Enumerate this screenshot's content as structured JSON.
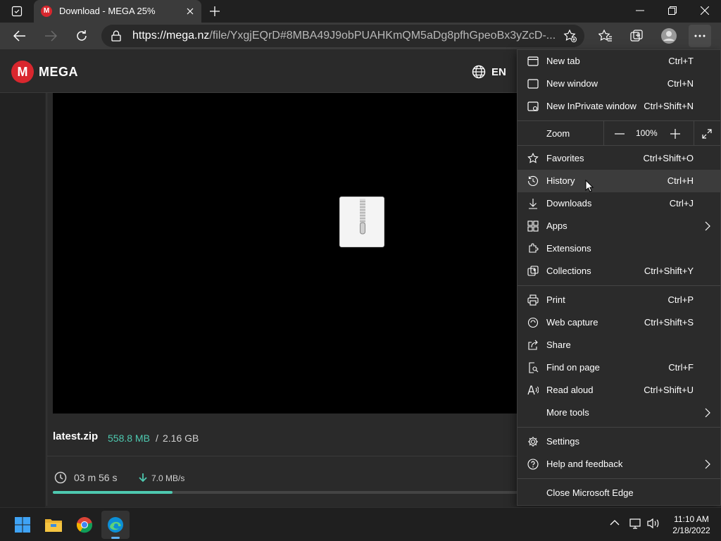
{
  "browser": {
    "tab_title": "Download - MEGA 25%",
    "tab_favicon": "M",
    "url_host": "https://mega.nz",
    "url_path": "/file/YxgjEQrD#8MBA49J9obPUAHKmQM5aDg8pfhGpeoBx3yZcD-..."
  },
  "mega": {
    "logo": "M",
    "name": "MEGA",
    "language": "EN",
    "file_name": "latest.zip",
    "downloaded": "558.8 MB",
    "separator": "/",
    "total": "2.16 GB",
    "time_left": "03 m  56 s",
    "speed": "7.0 MB/s",
    "progress": 0.25
  },
  "menu": {
    "new_tab": {
      "label": "New tab",
      "shortcut": "Ctrl+T"
    },
    "new_window": {
      "label": "New window",
      "shortcut": "Ctrl+N"
    },
    "new_inprivate": {
      "label": "New InPrivate window",
      "shortcut": "Ctrl+Shift+N"
    },
    "zoom": {
      "label": "Zoom",
      "value": "100%"
    },
    "favorites": {
      "label": "Favorites",
      "shortcut": "Ctrl+Shift+O"
    },
    "history": {
      "label": "History",
      "shortcut": "Ctrl+H"
    },
    "downloads": {
      "label": "Downloads",
      "shortcut": "Ctrl+J"
    },
    "apps": {
      "label": "Apps"
    },
    "extensions": {
      "label": "Extensions"
    },
    "collections": {
      "label": "Collections",
      "shortcut": "Ctrl+Shift+Y"
    },
    "print": {
      "label": "Print",
      "shortcut": "Ctrl+P"
    },
    "web_capture": {
      "label": "Web capture",
      "shortcut": "Ctrl+Shift+S"
    },
    "share": {
      "label": "Share"
    },
    "find": {
      "label": "Find on page",
      "shortcut": "Ctrl+F"
    },
    "read_aloud": {
      "label": "Read aloud",
      "shortcut": "Ctrl+Shift+U"
    },
    "more_tools": {
      "label": "More tools"
    },
    "settings": {
      "label": "Settings"
    },
    "help": {
      "label": "Help and feedback"
    },
    "close": {
      "label": "Close Microsoft Edge"
    }
  },
  "taskbar": {
    "time": "11:10 AM",
    "date": "2/18/2022"
  },
  "colors": {
    "accent_mega": "#d9272e",
    "progress": "#4ec9b0"
  }
}
